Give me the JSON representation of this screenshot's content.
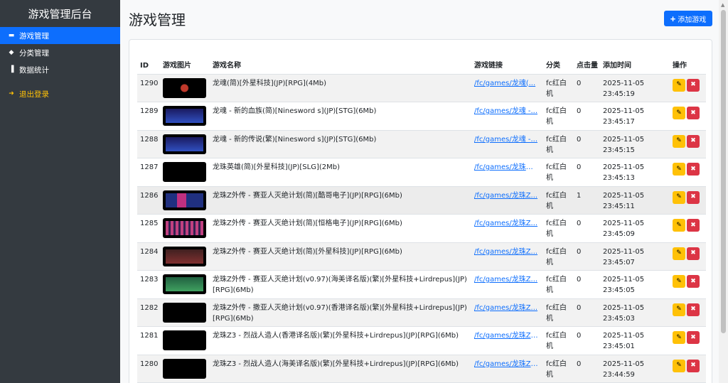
{
  "sidebar": {
    "brand": "游戏管理后台",
    "items": [
      {
        "label": "游戏管理",
        "icon": "gamepad-icon",
        "active": true
      },
      {
        "label": "分类管理",
        "icon": "tags-icon",
        "active": false
      },
      {
        "label": "数据统计",
        "icon": "chart-icon",
        "active": false
      }
    ],
    "logout": "退出登录"
  },
  "header": {
    "title": "游戏管理",
    "add_button": "添加游戏"
  },
  "table": {
    "columns": [
      "ID",
      "游戏图片",
      "游戏名称",
      "游戏链接",
      "分类",
      "点击量",
      "添加时间",
      "操作"
    ],
    "rows": [
      {
        "id": "1290",
        "name": "龙魂(简)[外星科技](JP)[RPG](4Mb)",
        "link": "/fc/games/龙魂(...",
        "category": "fc红白机",
        "clicks": "0",
        "date": "2025-11-05",
        "time": "23:45:19"
      },
      {
        "id": "1289",
        "name": "龙魂 - 新的血族(简)[Ninesword s](JP)[STG](6Mb)",
        "link": "/fc/games/龙魂 -...",
        "category": "fc红白机",
        "clicks": "0",
        "date": "2025-11-05",
        "time": "23:45:17"
      },
      {
        "id": "1288",
        "name": "龙魂 - 新的传说(繁)[Ninesword s](JP)[STG](6Mb)",
        "link": "/fc/games/龙魂 -...",
        "category": "fc红白机",
        "clicks": "0",
        "date": "2025-11-05",
        "time": "23:45:15"
      },
      {
        "id": "1287",
        "name": "龙珠英雄(简)[外星科技](JP)[SLG](2Mb)",
        "link": "/fc/games/龙珠英...",
        "category": "fc红白机",
        "clicks": "0",
        "date": "2025-11-05",
        "time": "23:45:13"
      },
      {
        "id": "1286",
        "name": "龙珠Z外传 - 赛亚人灭绝计划(简)[酷哥电子](JP)[RPG](6Mb)",
        "link": "/fc/games/龙珠Z...",
        "category": "fc红白机",
        "clicks": "1",
        "date": "2025-11-05",
        "time": "23:45:11"
      },
      {
        "id": "1285",
        "name": "龙珠Z外传 - 赛亚人灭绝计划(简)[恒格电子](JP)[RPG](6Mb)",
        "link": "/fc/games/龙珠Z...",
        "category": "fc红白机",
        "clicks": "0",
        "date": "2025-11-05",
        "time": "23:45:09"
      },
      {
        "id": "1284",
        "name": "龙珠Z外传 - 赛亚人灭绝计划(简)[外星科技](JP)[RPG](6Mb)",
        "link": "/fc/games/龙珠Z...",
        "category": "fc红白机",
        "clicks": "0",
        "date": "2025-11-05",
        "time": "23:45:07"
      },
      {
        "id": "1283",
        "name": "龙珠Z外传 - 赛亚人灭绝计划(v0.97)(海美译名版)(繁)[外星科技+Lirdrepus](JP)[RPG](6Mb)",
        "link": "/fc/games/龙珠Z...",
        "category": "fc红白机",
        "clicks": "0",
        "date": "2025-11-05",
        "time": "23:45:05"
      },
      {
        "id": "1282",
        "name": "龙珠Z外传 - 撒亚人灭绝计划(v0.97)(香港译名版)(繁)[外星科技+Lirdrepus](JP)[RPG](6Mb)",
        "link": "/fc/games/龙珠Z...",
        "category": "fc红白机",
        "clicks": "0",
        "date": "2025-11-05",
        "time": "23:45:03"
      },
      {
        "id": "1281",
        "name": "龙珠Z3 - 烈战人造人(香港译名版)(繁)[外星科技+Lirdrepus](JP)[RPG](6Mb)",
        "link": "/fc/games/龙珠Z3...",
        "category": "fc红白机",
        "clicks": "0",
        "date": "2025-11-05",
        "time": "23:45:01"
      },
      {
        "id": "1280",
        "name": "龙珠Z3 - 烈战人造人(海美译名版)(繁)[外星科技+Lirdrepus](JP)[RPG](6Mb)",
        "link": "/fc/games/龙珠Z3...",
        "category": "fc红白机",
        "clicks": "0",
        "date": "2025-11-05",
        "time": "23:44:59"
      }
    ]
  },
  "colors": {
    "sidebar_bg": "#343a40",
    "primary": "#0d6efd",
    "warning": "#ffc107",
    "danger": "#dc3545"
  }
}
